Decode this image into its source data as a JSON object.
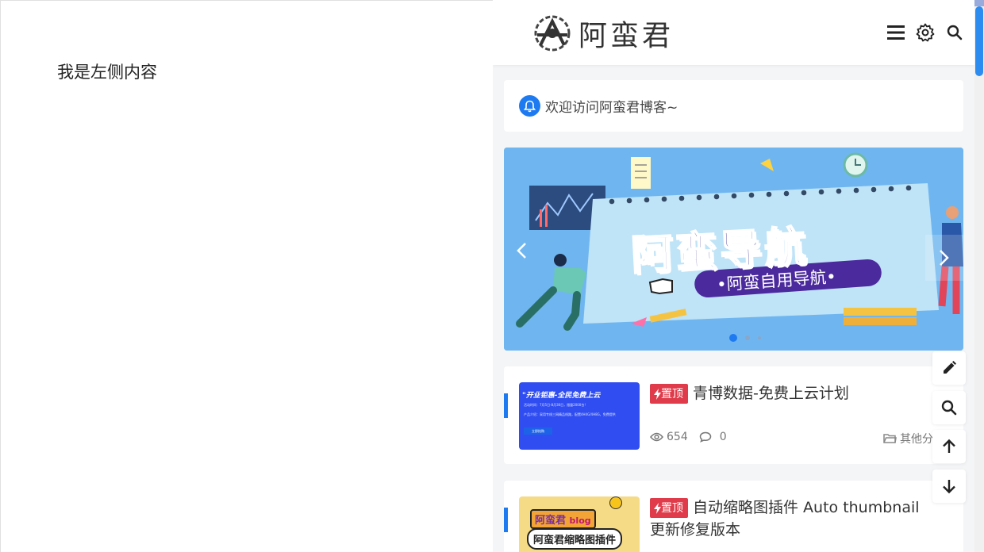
{
  "left": {
    "text": "我是左侧内容"
  },
  "header": {
    "logo_text": "阿蛮君",
    "icons": [
      "menu-icon",
      "gear-icon",
      "search-icon"
    ]
  },
  "notice": {
    "text": "欢迎访问阿蛮君博客~"
  },
  "banner": {
    "title": "阿蛮导航",
    "subtitle": "•阿蛮自用导航•",
    "slide_index": 1,
    "slide_count": 3
  },
  "posts": [
    {
      "badge": "置顶",
      "title": "青博数据-免费上云计划",
      "views": "654",
      "comments": "0",
      "category": "其他分",
      "thumb_title": "\"开业钜惠-全民免费上云",
      "thumb_line1": "活动时间：7月5日-8月30日，限量2000台!",
      "thumb_line2": "产品介绍：采用专线三网精品线路，配置4H4G/4H8G，免费提供",
      "thumb_button": "立即抢购"
    },
    {
      "badge": "置顶",
      "title": "自动缩略图插件 Auto thumbnail 更新修复版本",
      "thumb_brand": "阿蛮君",
      "thumb_blog": "blog",
      "thumb_caption": "阿蛮君缩略图插件"
    }
  ],
  "fabs": [
    "edit-icon",
    "search-icon",
    "arrow-up-icon",
    "arrow-down-icon"
  ],
  "colors": {
    "accent": "#1e7af0",
    "badge": "#e03b4a",
    "banner_bg": "#6fb6f0"
  }
}
